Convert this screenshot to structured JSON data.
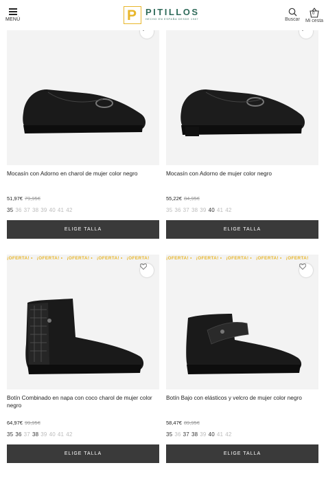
{
  "header": {
    "menu_label": "MENÚ",
    "logo_letter": "P",
    "logo_text": "PITILLOS",
    "logo_tagline": "HECHO EN ESPAÑA DESDE 1987",
    "search_label": "Buscar",
    "cart_label": "Mi cesta",
    "cart_count": "0",
    "accent_color": "#e8b62a",
    "brand_color": "#2f6b5a"
  },
  "products": [
    {
      "title": "Mocasín con Adorno en charol de mujer color negro",
      "price": "51,97€",
      "old_price": "79,95€",
      "promo": false,
      "sizes": [
        {
          "label": "35",
          "available": true
        },
        {
          "label": "36",
          "available": false
        },
        {
          "label": "37",
          "available": false
        },
        {
          "label": "38",
          "available": false
        },
        {
          "label": "39",
          "available": false
        },
        {
          "label": "40",
          "available": false
        },
        {
          "label": "41",
          "available": false
        },
        {
          "label": "42",
          "available": false
        }
      ],
      "button": "ELIGE TALLA"
    },
    {
      "title": "Mocasín con Adorno de mujer color negro",
      "price": "55,22€",
      "old_price": "84,95€",
      "promo": false,
      "sizes": [
        {
          "label": "35",
          "available": false
        },
        {
          "label": "36",
          "available": false
        },
        {
          "label": "37",
          "available": false
        },
        {
          "label": "38",
          "available": false
        },
        {
          "label": "39",
          "available": false
        },
        {
          "label": "40",
          "available": true
        },
        {
          "label": "41",
          "available": false
        },
        {
          "label": "42",
          "available": false
        }
      ],
      "button": "ELIGE TALLA"
    },
    {
      "title": "Botín Combinado en napa con coco charol de mujer color negro",
      "price": "64,97€",
      "old_price": "99,95€",
      "promo": true,
      "promo_text": "¡OFERTA!",
      "sizes": [
        {
          "label": "35",
          "available": true
        },
        {
          "label": "36",
          "available": true
        },
        {
          "label": "37",
          "available": false
        },
        {
          "label": "38",
          "available": true
        },
        {
          "label": "39",
          "available": false
        },
        {
          "label": "40",
          "available": false
        },
        {
          "label": "41",
          "available": false
        },
        {
          "label": "42",
          "available": false
        }
      ],
      "button": "ELIGE TALLA"
    },
    {
      "title": "Botín Bajo con elásticos y velcro de mujer color negro",
      "price": "58,47€",
      "old_price": "89,95€",
      "promo": true,
      "promo_text": "¡OFERTA!",
      "sizes": [
        {
          "label": "35",
          "available": true
        },
        {
          "label": "36",
          "available": false
        },
        {
          "label": "37",
          "available": true
        },
        {
          "label": "38",
          "available": true
        },
        {
          "label": "39",
          "available": false
        },
        {
          "label": "40",
          "available": true
        },
        {
          "label": "41",
          "available": false
        },
        {
          "label": "42",
          "available": false
        }
      ],
      "button": "ELIGE TALLA"
    }
  ]
}
